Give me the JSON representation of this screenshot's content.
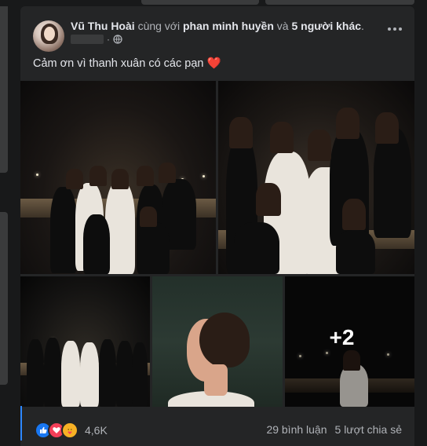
{
  "post": {
    "author": "Vũ Thu Hoài",
    "with_text": "cùng với",
    "tagged": "phan minh huyền",
    "and_text": "và",
    "others": "5 người khác",
    "caption": "Cảm ơn vì thanh xuân có các pạn",
    "caption_emoji": "❤️",
    "privacy_icon": "globe-icon"
  },
  "photos": {
    "more_count": "+2"
  },
  "footer": {
    "reaction_count": "4,6K",
    "comments": "29 bình luận",
    "shares": "5 lượt chia sẻ",
    "reactions": [
      "like-icon",
      "love-icon",
      "care-icon"
    ]
  },
  "colors": {
    "background": "#18191a",
    "card": "#242526",
    "text": "#e4e6eb",
    "muted": "#b0b3b8",
    "like": "#1877f2",
    "love": "#f33e58",
    "care": "#f7b125"
  }
}
